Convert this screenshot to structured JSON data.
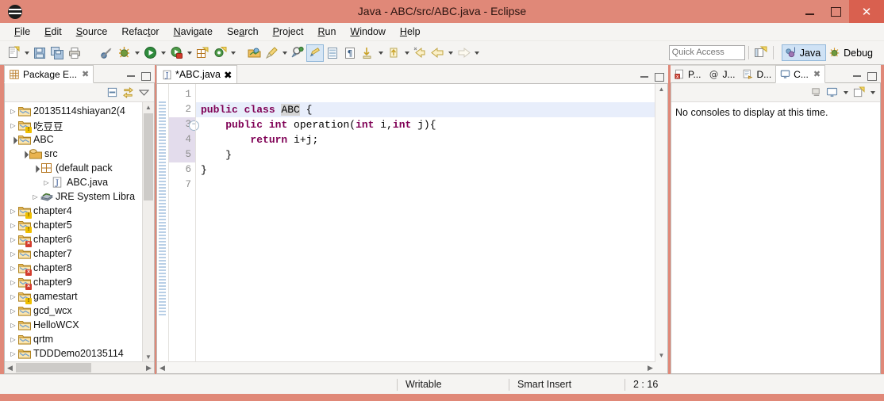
{
  "window": {
    "title": "Java - ABC/src/ABC.java - Eclipse",
    "app_icon": "eclipse-icon",
    "minimize": "–",
    "maximize": "□",
    "close": "✕",
    "titlebar_color": "#e08878",
    "close_hover_color": "#d9604f"
  },
  "menu": [
    {
      "label": "File",
      "mnemonic": "F"
    },
    {
      "label": "Edit",
      "mnemonic": "E"
    },
    {
      "label": "Source",
      "mnemonic": "S"
    },
    {
      "label": "Refactor",
      "mnemonic": "t"
    },
    {
      "label": "Navigate",
      "mnemonic": "N"
    },
    {
      "label": "Search",
      "mnemonic": "a"
    },
    {
      "label": "Project",
      "mnemonic": "P"
    },
    {
      "label": "Run",
      "mnemonic": "R"
    },
    {
      "label": "Window",
      "mnemonic": "W"
    },
    {
      "label": "Help",
      "mnemonic": "H"
    }
  ],
  "toolbar": {
    "quick_access_placeholder": "Quick Access",
    "quick_access_value": "",
    "perspectives": [
      {
        "label": "Java",
        "active": true
      },
      {
        "label": "Debug",
        "active": false
      }
    ],
    "buttons": [
      "new-wizard-button",
      "new-wizard-dropdown",
      "save-button",
      "save-all-button",
      "print-button",
      "toggle-breakpoint-button",
      "debug-button",
      "debug-dropdown",
      "run-button",
      "run-dropdown",
      "coverage-button",
      "coverage-dropdown",
      "new-java-package-button",
      "new-java-class-button",
      "new-java-class-dropdown",
      "open-type-button",
      "search-button",
      "search-dropdown",
      "external-tools-button",
      "edit-selected-button",
      "toggle-mark-occurrences-button",
      "show-whitespace-button",
      "skip-all-breakpoints-button",
      "skip-dropdown",
      "next-annotation-button",
      "next-annotation-dropdown",
      "previous-edit-button",
      "back-button",
      "back-dropdown",
      "forward-button",
      "forward-dropdown"
    ]
  },
  "package_explorer": {
    "tab_label": "Package E...",
    "tab_icon": "package-explorer-icon",
    "close_icon": "✖",
    "minimize_icon": "minimize-icon",
    "maximize_icon": "maximize-icon",
    "local_tools": [
      "collapse-all-icon",
      "link-with-editor-icon",
      "view-menu-icon"
    ],
    "tree": [
      {
        "label": "20135114shiayan2(4",
        "indent": 0,
        "state": "closed",
        "icon": "project-icon",
        "badge": "none"
      },
      {
        "label": "吃豆豆",
        "indent": 0,
        "state": "closed",
        "icon": "project-icon",
        "badge": "warning"
      },
      {
        "label": "ABC",
        "indent": 0,
        "state": "open",
        "icon": "project-icon",
        "badge": "none"
      },
      {
        "label": "src",
        "indent": 1,
        "state": "open",
        "icon": "source-folder-icon",
        "badge": "none"
      },
      {
        "label": "(default pack",
        "indent": 2,
        "state": "open",
        "icon": "package-icon",
        "badge": "none"
      },
      {
        "label": "ABC.java",
        "indent": 3,
        "state": "closed",
        "icon": "java-file-icon",
        "badge": "none"
      },
      {
        "label": "JRE System Libra",
        "indent": 2,
        "state": "closed",
        "icon": "jre-library-icon",
        "badge": "none"
      },
      {
        "label": "chapter4",
        "indent": 0,
        "state": "closed",
        "icon": "project-icon",
        "badge": "warning"
      },
      {
        "label": "chapter5",
        "indent": 0,
        "state": "closed",
        "icon": "project-icon",
        "badge": "warning"
      },
      {
        "label": "chapter6",
        "indent": 0,
        "state": "closed",
        "icon": "project-icon",
        "badge": "error"
      },
      {
        "label": "chapter7",
        "indent": 0,
        "state": "closed",
        "icon": "project-icon",
        "badge": "none"
      },
      {
        "label": "chapter8",
        "indent": 0,
        "state": "closed",
        "icon": "project-icon",
        "badge": "error"
      },
      {
        "label": "chapter9",
        "indent": 0,
        "state": "closed",
        "icon": "project-icon",
        "badge": "error"
      },
      {
        "label": "gamestart",
        "indent": 0,
        "state": "closed",
        "icon": "project-icon",
        "badge": "warning"
      },
      {
        "label": "gcd_wcx",
        "indent": 0,
        "state": "closed",
        "icon": "project-icon",
        "badge": "none"
      },
      {
        "label": "HelloWCX",
        "indent": 0,
        "state": "closed",
        "icon": "project-icon",
        "badge": "none"
      },
      {
        "label": "qrtm",
        "indent": 0,
        "state": "closed",
        "icon": "project-icon",
        "badge": "none"
      },
      {
        "label": "TDDDemo20135114",
        "indent": 0,
        "state": "closed",
        "icon": "project-icon",
        "badge": "none"
      }
    ]
  },
  "editor": {
    "tab_label": "*ABC.java",
    "tab_icon": "java-file-icon",
    "tab_close_icon": "✖",
    "minimize_icon": "minimize-icon",
    "maximize_icon": "maximize-icon",
    "current_line": 2,
    "folded_line": 3,
    "fold_glyph": "⊖",
    "lines": [
      {
        "num": "1",
        "text": "",
        "tokens": []
      },
      {
        "num": "2",
        "text": "public class ABC {",
        "tokens": [
          {
            "t": "public",
            "k": "kw"
          },
          {
            "t": " "
          },
          {
            "t": "class",
            "k": "kw"
          },
          {
            "t": " "
          },
          {
            "t": "ABC",
            "k": "occ"
          },
          {
            "t": " {"
          }
        ]
      },
      {
        "num": "3",
        "text": "    public int operation(int i,int j){",
        "tokens": [
          {
            "t": "    "
          },
          {
            "t": "public",
            "k": "kw"
          },
          {
            "t": " "
          },
          {
            "t": "int",
            "k": "kw"
          },
          {
            "t": " operation("
          },
          {
            "t": "int",
            "k": "kw"
          },
          {
            "t": " i,"
          },
          {
            "t": "int",
            "k": "kw"
          },
          {
            "t": " j){"
          }
        ]
      },
      {
        "num": "4",
        "text": "        return i+j;",
        "tokens": [
          {
            "t": "        "
          },
          {
            "t": "return",
            "k": "kw"
          },
          {
            "t": " i+j;"
          }
        ]
      },
      {
        "num": "5",
        "text": "    }",
        "tokens": [
          {
            "t": "    }"
          }
        ]
      },
      {
        "num": "6",
        "text": "}",
        "tokens": [
          {
            "t": "}"
          }
        ]
      },
      {
        "num": "7",
        "text": "",
        "tokens": []
      }
    ]
  },
  "bottom_right_view": {
    "tabs": [
      {
        "label": "P...",
        "icon": "problems-icon",
        "active": false
      },
      {
        "label": "J...",
        "icon": "javadoc-icon",
        "active": false
      },
      {
        "label": "D...",
        "icon": "declaration-icon",
        "active": false
      },
      {
        "label": "C...",
        "icon": "console-icon",
        "active": true
      }
    ],
    "close_icon": "✖",
    "minimize_icon": "minimize-icon",
    "maximize_icon": "maximize-icon",
    "local_tools": [
      "pin-console-icon",
      "display-selected-console-icon",
      "display-console-dropdown",
      "open-console-icon",
      "open-console-dropdown"
    ],
    "message": "No consoles to display at this time."
  },
  "status_bar": {
    "writable": "Writable",
    "insert_mode": "Smart Insert",
    "position": "2 : 16"
  }
}
